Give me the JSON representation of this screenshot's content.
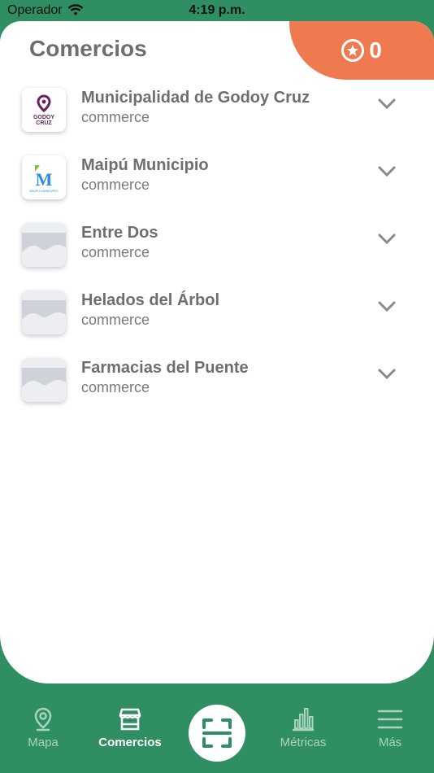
{
  "status_bar": {
    "carrier": "Operador",
    "time": "4:19 p.m."
  },
  "header": {
    "title": "Comercios",
    "points": "0"
  },
  "commerces": [
    {
      "name": "Municipalidad de Godoy Cruz",
      "type": "commerce",
      "logo": "godoy-cruz-logo",
      "logo_text": "GODOY CRUZ"
    },
    {
      "name": "Maipú Municipio",
      "type": "commerce",
      "logo": "maipu-logo",
      "logo_text": "MAIPÚ MUNICIPIO"
    },
    {
      "name": "Entre Dos",
      "type": "commerce",
      "logo": "placeholder-image"
    },
    {
      "name": "Helados del Árbol",
      "type": "commerce",
      "logo": "placeholder-image"
    },
    {
      "name": "Farmacias del Puente",
      "type": "commerce",
      "logo": "placeholder-image"
    }
  ],
  "tabbar": {
    "map": "Mapa",
    "commerces": "Comercios",
    "metrics": "Métricas",
    "more": "Más"
  },
  "colors": {
    "brand_green": "#2f8f63",
    "accent_orange": "#f07a4f",
    "godoy_purple": "#6a1f5e",
    "maipu_blue": "#2a8fd6"
  }
}
